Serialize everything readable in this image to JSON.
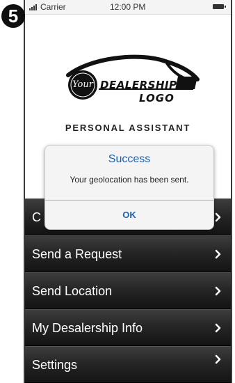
{
  "step_badge": "5",
  "status_bar": {
    "carrier": "Carrier",
    "time": "12:00 PM"
  },
  "logo": {
    "your": "Your",
    "line1": "DEALERSHIP",
    "line2": "LOGO"
  },
  "title": "PERSONAL ASSISTANT",
  "menu": {
    "items": [
      {
        "label": "C"
      },
      {
        "label": "Send a Request"
      },
      {
        "label": "Send Location"
      },
      {
        "label": "My Desalership Info"
      },
      {
        "label": "Settings"
      }
    ]
  },
  "alert": {
    "title": "Success",
    "message": "Your geolocation has been sent.",
    "ok_label": "OK"
  },
  "colors": {
    "alert_accent": "#1f5fae",
    "menu_dark": "#141414"
  }
}
